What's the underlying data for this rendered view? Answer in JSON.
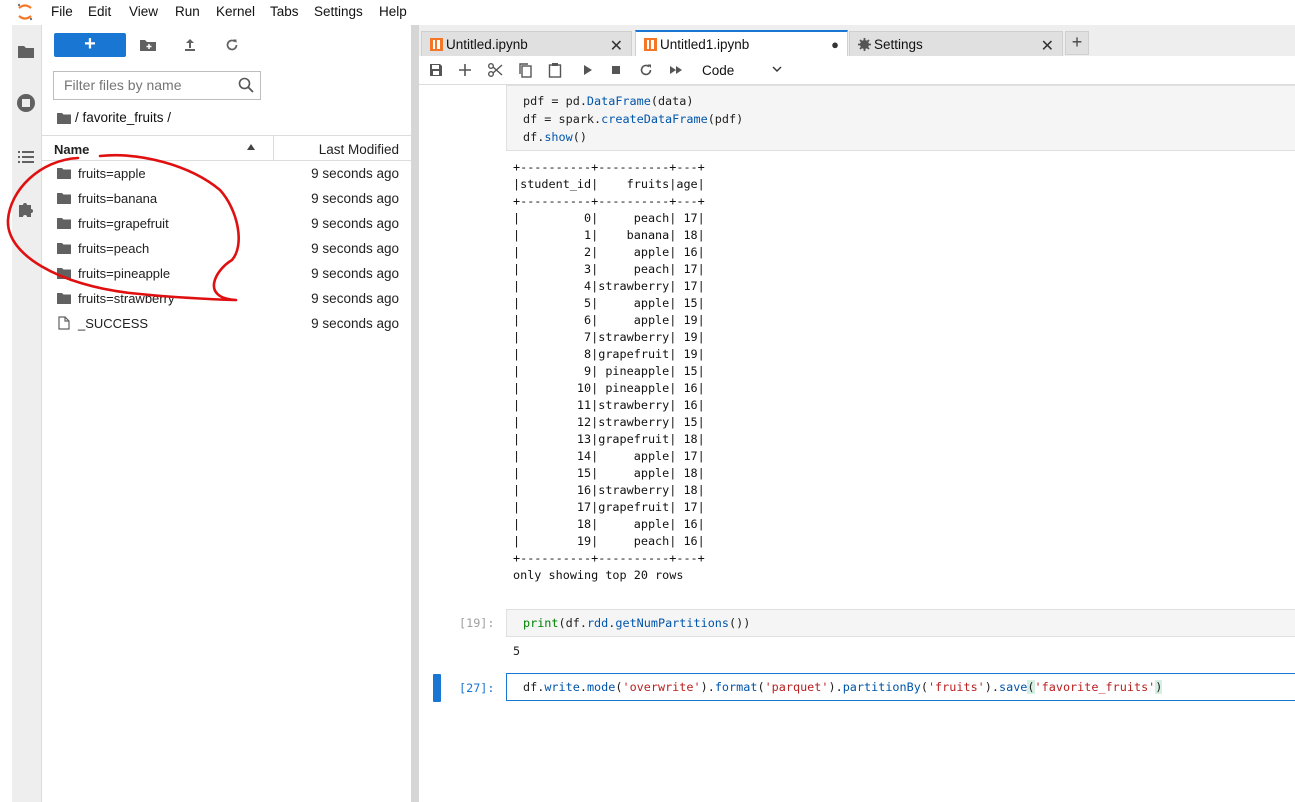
{
  "menu": [
    "File",
    "Edit",
    "View",
    "Run",
    "Kernel",
    "Tabs",
    "Settings",
    "Help"
  ],
  "browser": {
    "new_label": "+",
    "filter_placeholder": "Filter files by name",
    "breadcrumb": "/ favorite_fruits /",
    "col_name": "Name",
    "col_modified": "Last Modified",
    "files": [
      {
        "name": "fruits=apple",
        "modified": "9 seconds ago",
        "type": "folder"
      },
      {
        "name": "fruits=banana",
        "modified": "9 seconds ago",
        "type": "folder"
      },
      {
        "name": "fruits=grapefruit",
        "modified": "9 seconds ago",
        "type": "folder"
      },
      {
        "name": "fruits=peach",
        "modified": "9 seconds ago",
        "type": "folder"
      },
      {
        "name": "fruits=pineapple",
        "modified": "9 seconds ago",
        "type": "folder"
      },
      {
        "name": "fruits=strawberry",
        "modified": "9 seconds ago",
        "type": "folder"
      },
      {
        "name": "_SUCCESS",
        "modified": "9 seconds ago",
        "type": "file"
      }
    ]
  },
  "tabs": [
    {
      "label": "Untitled.ipynb",
      "close": "✕"
    },
    {
      "label": "Untitled1.ipynb",
      "close": "●"
    },
    {
      "label": "Settings",
      "close": "✕"
    }
  ],
  "add_tab": "+",
  "toolbar": {
    "cell_type": "Code"
  },
  "cells": {
    "c1": {
      "line1_a": "pdf = pd.",
      "line1_b": "DataFrame",
      "line1_c": "(data)",
      "line2_a": "df = spark.",
      "line2_b": "createDataFrame",
      "line2_c": "(pdf)",
      "line3_a": "df.",
      "line3_b": "show",
      "line3_c": "()",
      "output": "+----------+----------+---+\n|student_id|    fruits|age|\n+----------+----------+---+\n|         0|     peach| 17|\n|         1|    banana| 18|\n|         2|     apple| 16|\n|         3|     peach| 17|\n|         4|strawberry| 17|\n|         5|     apple| 15|\n|         6|     apple| 19|\n|         7|strawberry| 19|\n|         8|grapefruit| 19|\n|         9| pineapple| 15|\n|        10| pineapple| 16|\n|        11|strawberry| 16|\n|        12|strawberry| 15|\n|        13|grapefruit| 18|\n|        14|     apple| 17|\n|        15|     apple| 18|\n|        16|strawberry| 18|\n|        17|grapefruit| 17|\n|        18|     apple| 16|\n|        19|     peach| 16|\n+----------+----------+---+\nonly showing top 20 rows"
    },
    "c2": {
      "prompt": "[19]:",
      "code_a": "print",
      "code_b": "(df.",
      "code_c": "rdd",
      "code_d": ".",
      "code_e": "getNumPartitions",
      "code_f": "())",
      "output": "5"
    },
    "c3": {
      "prompt": "[27]:",
      "t1": "df.",
      "t2": "write",
      "t3": ".",
      "t4": "mode",
      "t5": "(",
      "t6": "'overwrite'",
      "t7": ").",
      "t8": "format",
      "t9": "(",
      "t10": "'parquet'",
      "t11": ").",
      "t12": "partitionBy",
      "t13": "(",
      "t14": "'fruits'",
      "t15": ").",
      "t16": "save",
      "t17": "(",
      "t18": "'favorite_fruits'",
      "t19": ")"
    }
  },
  "colors": {
    "accent": "#1976d2",
    "annotation": "#e01010"
  }
}
